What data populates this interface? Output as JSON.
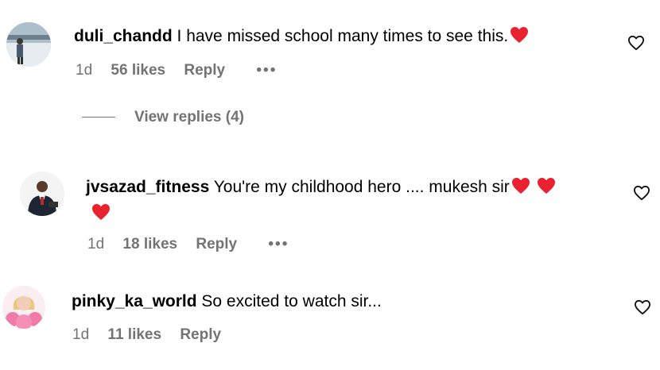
{
  "comments": [
    {
      "username": "duli_chandd",
      "text": "I have missed school many times to see this.",
      "time": "1d",
      "likes": "56 likes",
      "reply": "Reply",
      "more": "•••"
    },
    {
      "username": "jvsazad_fitness",
      "text": "You're my childhood hero .... mukesh sir",
      "time": "1d",
      "likes": "18 likes",
      "reply": "Reply",
      "more": "•••"
    },
    {
      "username": "pinky_ka_world",
      "text": "So excited to watch sir...",
      "time": "1d",
      "likes": "11 likes",
      "reply": "Reply"
    }
  ],
  "view_replies": "View replies (4)",
  "icons": {
    "heart_emoji": "red-heart-emoji",
    "like": "heart-outline-icon",
    "more": "ellipsis-icon"
  },
  "colors": {
    "heart_red": "#e8232f",
    "meta_gray": "#737373"
  }
}
